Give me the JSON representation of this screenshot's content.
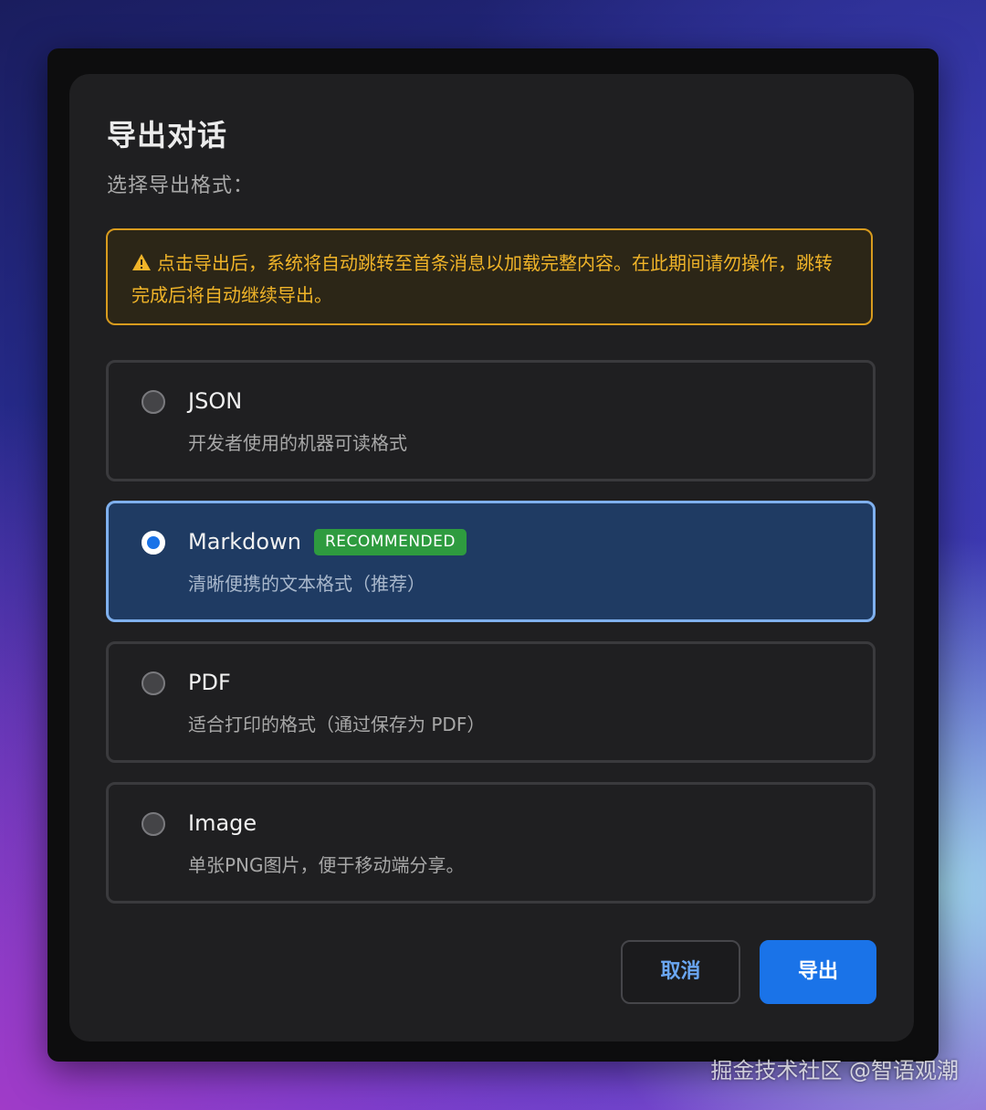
{
  "dialog": {
    "title": "导出对话",
    "subtitle": "选择导出格式："
  },
  "warning": {
    "icon": "warning-triangle-icon",
    "text": "点击导出后，系统将自动跳转至首条消息以加载完整内容。在此期间请勿操作，跳转完成后将自动继续导出。",
    "color": "#f0b429"
  },
  "options": [
    {
      "label": "JSON",
      "description": "开发者使用的机器可读格式",
      "selected": false
    },
    {
      "label": "Markdown",
      "badge": "RECOMMENDED",
      "description": "清晰便携的文本格式（推荐）",
      "selected": true
    },
    {
      "label": "PDF",
      "description": "适合打印的格式（通过保存为 PDF）",
      "selected": false
    },
    {
      "label": "Image",
      "description": "单张PNG图片，便于移动端分享。",
      "selected": false
    }
  ],
  "buttons": {
    "cancel_label": "取消",
    "export_label": "导出"
  },
  "watermark": "掘金技术社区 @智语观潮",
  "colors": {
    "accent": "#1a73e8",
    "selected_bg": "#1f3b63",
    "selected_border": "#7fb0ee",
    "badge": "#2e9b3f",
    "warning": "#d89b1e"
  }
}
